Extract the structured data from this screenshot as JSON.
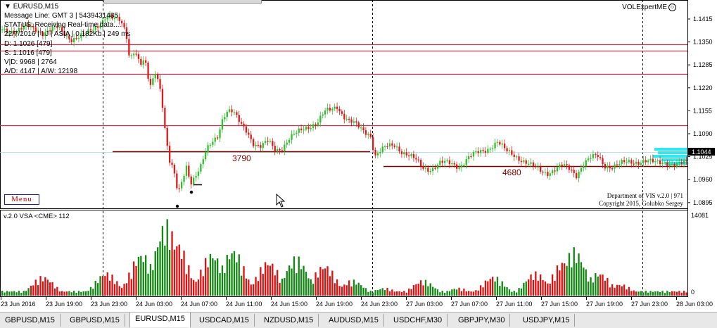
{
  "chart_window": {
    "symbol_label": "EURUSD,M15",
    "expert_name": "VOLExpertME",
    "expert_icon": "smiley-icon"
  },
  "info_panel": {
    "lines": [
      "Message Line: GMT 3 | 5439431485",
      "STATUS:  Receiving Real-time data....",
      "22/7/2016 | I J | ASIA | 0.182Kb | 249 ms",
      "D: 1.1026 [479]",
      "S: 1.1016 [479]",
      "V|D: 9968 | 2764",
      "A/D: 4147 | A/W: 12198"
    ]
  },
  "menu_button": {
    "label": "Menu"
  },
  "credits": {
    "line1": "Department of VIS v.2.0 | 971",
    "line2": "Copyright 2015, Golubko Sergey"
  },
  "price_panel": {
    "current_price": "1.1044",
    "y_ticks": [
      "1.1415",
      "1.1350",
      "1.1285",
      "1.1220",
      "1.1155",
      "1.1090",
      "1.1025",
      "1.0960",
      "1.0895"
    ],
    "level_labels": [
      "3790",
      "4680"
    ]
  },
  "volume_panel": {
    "indicator_label": "v.2.0 VSA <CME> 112",
    "max_label": "14081",
    "zero_label": "0"
  },
  "x_axis": {
    "labels": [
      "23 Jun 2016",
      "23 Jun 19:00",
      "23 Jun 23:00",
      "24 Jun 03:00",
      "24 Jun 07:00",
      "24 Jun 11:00",
      "24 Jun 15:00",
      "24 Jun 19:00",
      "24 Jun 23:00",
      "27 Jun 03:00",
      "27 Jun 07:00",
      "27 Jun 11:00",
      "27 Jun 15:00",
      "27 Jun 19:00",
      "27 Jun 23:00",
      "28 Jun 03:00"
    ]
  },
  "tabs": [
    {
      "label": "GBPUSD,M15",
      "active": false
    },
    {
      "label": "GBPUSD,M15",
      "active": false
    },
    {
      "label": "EURUSD,M15",
      "active": true
    },
    {
      "label": "USDCAD,M15",
      "active": false
    },
    {
      "label": "NZDUSD,M15",
      "active": false
    },
    {
      "label": "AUDUSD,M15",
      "active": false
    },
    {
      "label": "USDCHF,M30",
      "active": false
    },
    {
      "label": "GBPJPY,M30",
      "active": false
    },
    {
      "label": "USDJPY,M15",
      "active": false
    }
  ],
  "colors": {
    "bull": "#2fbf2f",
    "bear": "#e01818",
    "level_line": "#c0304a",
    "support_line": "#7a0000",
    "vol_green": "#118811",
    "vol_red": "#dd1010",
    "price_tag_bg": "#000000"
  }
}
